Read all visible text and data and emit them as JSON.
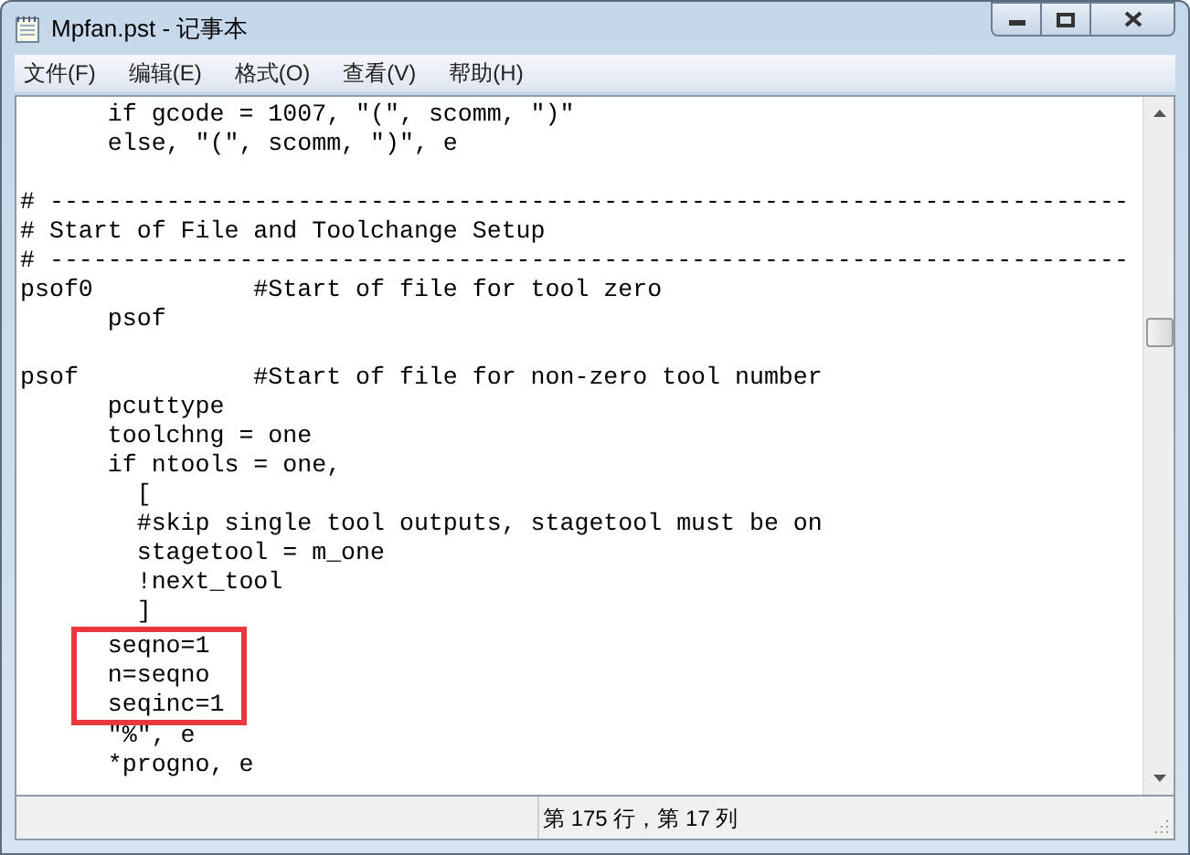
{
  "window": {
    "title": "Mpfan.pst - 记事本"
  },
  "menu": [
    "文件(F)",
    "编辑(E)",
    "格式(O)",
    "查看(V)",
    "帮助(H)"
  ],
  "lines": [
    {
      "kind": "text",
      "text": "      if gcode = 1007, \"(\", scomm, \")\"",
      "highlighted": false
    },
    {
      "kind": "text",
      "text": "      else, \"(\", scomm, \")\", e",
      "highlighted": false
    },
    {
      "kind": "blank"
    },
    {
      "kind": "text",
      "text": "# --------------------------------------------------------------------------",
      "highlighted": false
    },
    {
      "kind": "text",
      "text": "# Start of File and Toolchange Setup",
      "highlighted": false
    },
    {
      "kind": "text",
      "text": "# --------------------------------------------------------------------------",
      "highlighted": false
    },
    {
      "kind": "text",
      "text": "psof0           #Start of file for tool zero",
      "highlighted": false
    },
    {
      "kind": "text",
      "text": "      psof",
      "highlighted": false
    },
    {
      "kind": "blank"
    },
    {
      "kind": "text",
      "text": "psof            #Start of file for non-zero tool number",
      "highlighted": false
    },
    {
      "kind": "text",
      "text": "      pcuttype",
      "highlighted": false
    },
    {
      "kind": "text",
      "text": "      toolchng = one",
      "highlighted": false
    },
    {
      "kind": "text",
      "text": "      if ntools = one,",
      "highlighted": false
    },
    {
      "kind": "text",
      "text": "        [",
      "highlighted": false
    },
    {
      "kind": "text",
      "text": "        #skip single tool outputs, stagetool must be on",
      "highlighted": false
    },
    {
      "kind": "text",
      "text": "        stagetool = m_one",
      "highlighted": false
    },
    {
      "kind": "text",
      "text": "        !next_tool",
      "highlighted": false
    },
    {
      "kind": "text",
      "text": "        ]",
      "highlighted": false
    },
    {
      "kind": "text",
      "text": "      seqno=1",
      "highlighted": true
    },
    {
      "kind": "text",
      "text": "      n=seqno",
      "highlighted": true
    },
    {
      "kind": "text",
      "text": "      seqinc=1",
      "highlighted": true
    },
    {
      "kind": "text",
      "text": "      \"%\", e",
      "highlighted": false
    },
    {
      "kind": "text",
      "text": "      *progno, e",
      "highlighted": false
    }
  ],
  "status_bar": {
    "position": "第 175 行，第 17 列"
  }
}
